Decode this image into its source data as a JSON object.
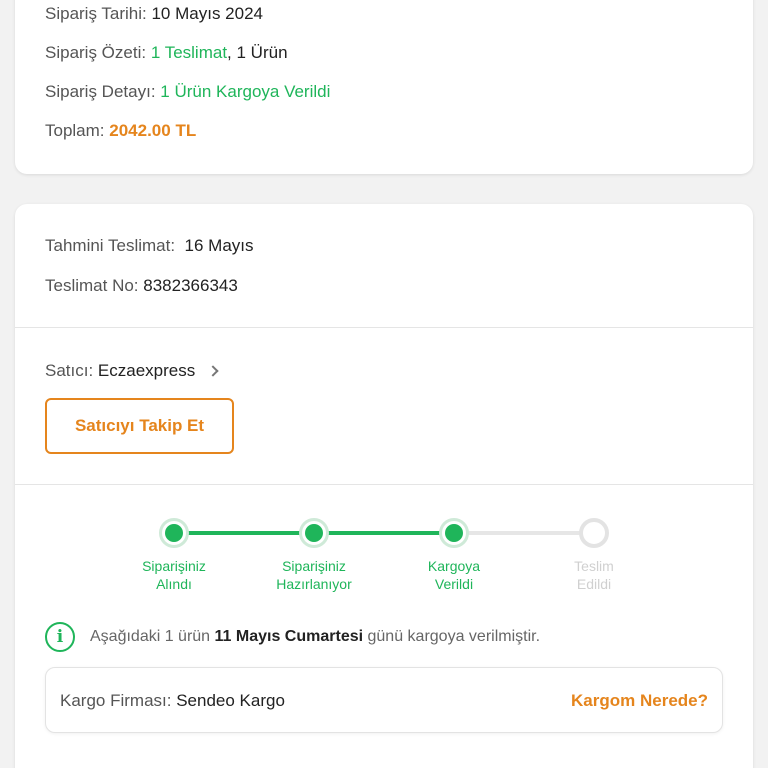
{
  "order_summary": {
    "date_label": "Sipariş Tarihi:",
    "date_value": "10 Mayıs 2024",
    "summary_label": "Sipariş Özeti:",
    "summary_delivery": "1 Teslimat",
    "summary_items": ", 1 Ürün",
    "detail_label": "Sipariş Detayı:",
    "detail_value": "1 Ürün Kargoya Verildi",
    "total_label": "Toplam:",
    "total_value": "2042.00 TL"
  },
  "delivery": {
    "estimated_label": "Tahmini Teslimat:",
    "estimated_value": "16 Mayıs",
    "delivery_no_label": "Teslimat No:",
    "delivery_no_value": "8382366343",
    "seller_label": "Satıcı:",
    "seller_name": "Eczaexpress",
    "follow_button": "Satıcıyı Takip Et"
  },
  "tracking": {
    "steps": [
      {
        "label": "Siparişiniz\nAlındı",
        "status": "done"
      },
      {
        "label": "Siparişiniz\nHazırlanıyor",
        "status": "done"
      },
      {
        "label": "Kargoya\nVerildi",
        "status": "done"
      },
      {
        "label": "Teslim\nEdildi",
        "status": "pending"
      }
    ],
    "info_pre": "Aşağıdaki 1 ürün ",
    "info_bold": "11 Mayıs Cumartesi",
    "info_post": " günü kargoya verilmiştir.",
    "info_icon": "info-icon"
  },
  "cargo": {
    "company_label": "Kargo Firması:",
    "company_value": "Sendeo Kargo",
    "where_link": "Kargom Nerede?"
  },
  "colors": {
    "green": "#1fb55a",
    "orange": "#e5851d",
    "background": "#f2f2f2"
  }
}
